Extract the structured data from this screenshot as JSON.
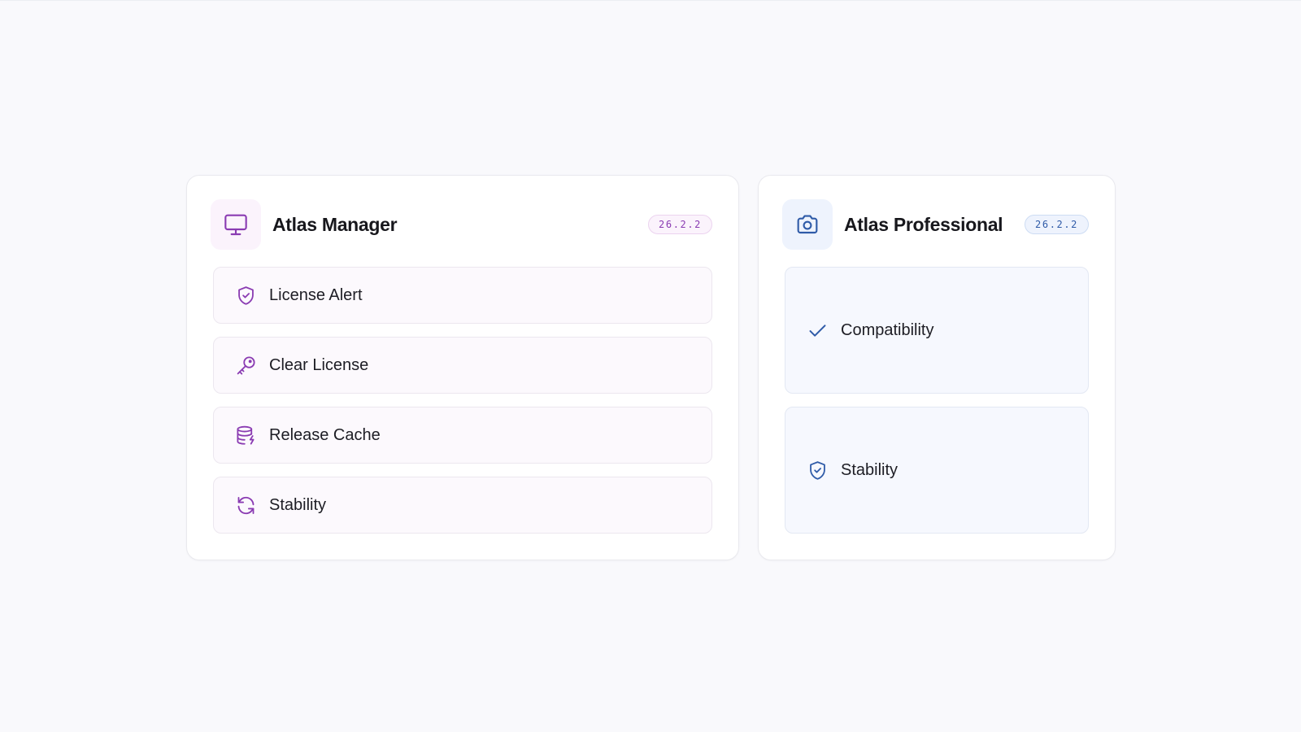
{
  "colors": {
    "manager_accent": "#8a3bb2",
    "manager_tint": "#fbf3fc",
    "manager_badge_border": "#ecd3ef",
    "pro_accent": "#2f5ba8",
    "pro_tint": "#eef3fd",
    "pro_badge_border": "#cddcf3"
  },
  "cards": [
    {
      "title": "Atlas Manager",
      "icon": "monitor-icon",
      "version": "26.2.2",
      "items": [
        {
          "label": "License Alert",
          "icon": "shield-check-icon"
        },
        {
          "label": "Clear License",
          "icon": "key-icon"
        },
        {
          "label": "Release Cache",
          "icon": "database-bolt-icon"
        },
        {
          "label": "Stability",
          "icon": "refresh-icon"
        }
      ]
    },
    {
      "title": "Atlas Professional",
      "icon": "camera-icon",
      "version": "26.2.2",
      "items": [
        {
          "label": "Compatibility",
          "icon": "check-icon"
        },
        {
          "label": "Stability",
          "icon": "shield-check-icon"
        }
      ]
    }
  ]
}
